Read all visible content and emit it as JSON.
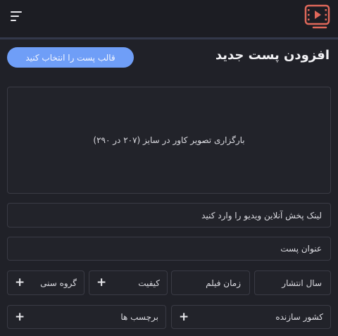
{
  "header": {
    "menu_icon": "hamburger-menu-icon",
    "logo_icon": "video-play-icon",
    "accent_color": "#e0685a"
  },
  "page": {
    "title": "افزودن پست جدید",
    "template_button": "قالب پست را انتخاب کنید",
    "button_color": "#6f9ef7"
  },
  "upload": {
    "label": "بارگزاری تصویر کاور در سایز (۲۰۷ در ۲۹۰)"
  },
  "fields": {
    "video_link_placeholder": "لینک پخش آنلاین ویدیو را وارد کنید",
    "post_title_placeholder": "عنوان پست",
    "release_year_placeholder": "سال انتشار",
    "duration_placeholder": "زمان فیلم"
  },
  "selects": {
    "quality": "کیفیت",
    "age_group": "گروه سنی",
    "country": "کشور سازنده",
    "tags": "برچسب ها",
    "add_symbol": "+"
  }
}
